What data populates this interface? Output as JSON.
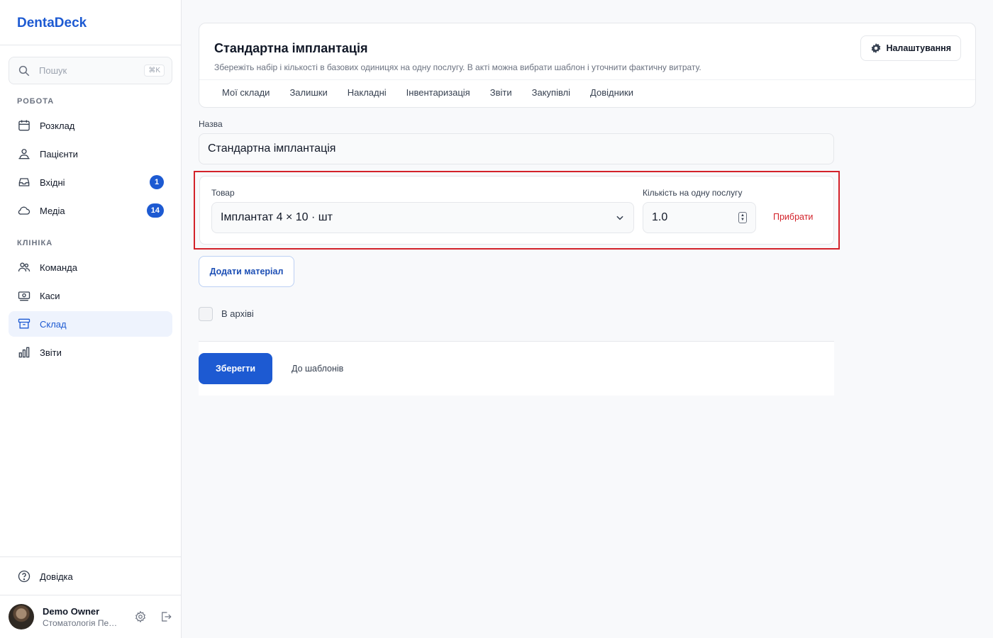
{
  "app": {
    "brand": "DentaDeck"
  },
  "sidebar": {
    "search": {
      "placeholder": "Пошук",
      "shortcut": "⌘K"
    },
    "sections": [
      {
        "label": "РОБОТА",
        "items": [
          {
            "label": "Розклад",
            "icon": "calendar-icon"
          },
          {
            "label": "Пацієнти",
            "icon": "patients-icon"
          },
          {
            "label": "Вхідні",
            "icon": "inbox-icon",
            "badge": "1"
          },
          {
            "label": "Медіа",
            "icon": "cloud-icon",
            "badge": "14"
          }
        ]
      },
      {
        "label": "КЛІНІКА",
        "items": [
          {
            "label": "Команда",
            "icon": "team-icon"
          },
          {
            "label": "Каси",
            "icon": "cash-register-icon"
          },
          {
            "label": "Склад",
            "icon": "archive-box-icon",
            "active": true
          },
          {
            "label": "Звіти",
            "icon": "bar-chart-icon"
          }
        ]
      }
    ],
    "help": {
      "label": "Довідка",
      "icon": "help-circle-icon"
    },
    "user": {
      "name": "Demo Owner",
      "org": "Стоматологія Пе…"
    }
  },
  "header": {
    "title": "Стандартна імплантація",
    "subtitle": "Збережіть набір і кількості в базових одиницях на одну послугу. В акті можна вибрати шаблон і уточнити фактичну витрату.",
    "settings_label": "Налаштування",
    "tabs": [
      "Мої склади",
      "Залишки",
      "Накладні",
      "Інвентаризація",
      "Звіти",
      "Закупівлі",
      "Довідники"
    ]
  },
  "form": {
    "name_label": "Назва",
    "name_value": "Стандартна імплантація",
    "material": {
      "product_label": "Товар",
      "product_value": "Імплантат 4 × 10 · шт",
      "qty_label": "Кількість на одну послугу",
      "qty_value": "1.0",
      "remove_label": "Прибрати"
    },
    "add_material_label": "Додати матеріал",
    "archived_label": "В архіві",
    "archived": false,
    "save_label": "Зберегти",
    "back_label": "До шаблонів"
  },
  "colors": {
    "accent": "#1d5ad2",
    "danger": "#d3222a",
    "highlight_frame": "#d3222a"
  }
}
